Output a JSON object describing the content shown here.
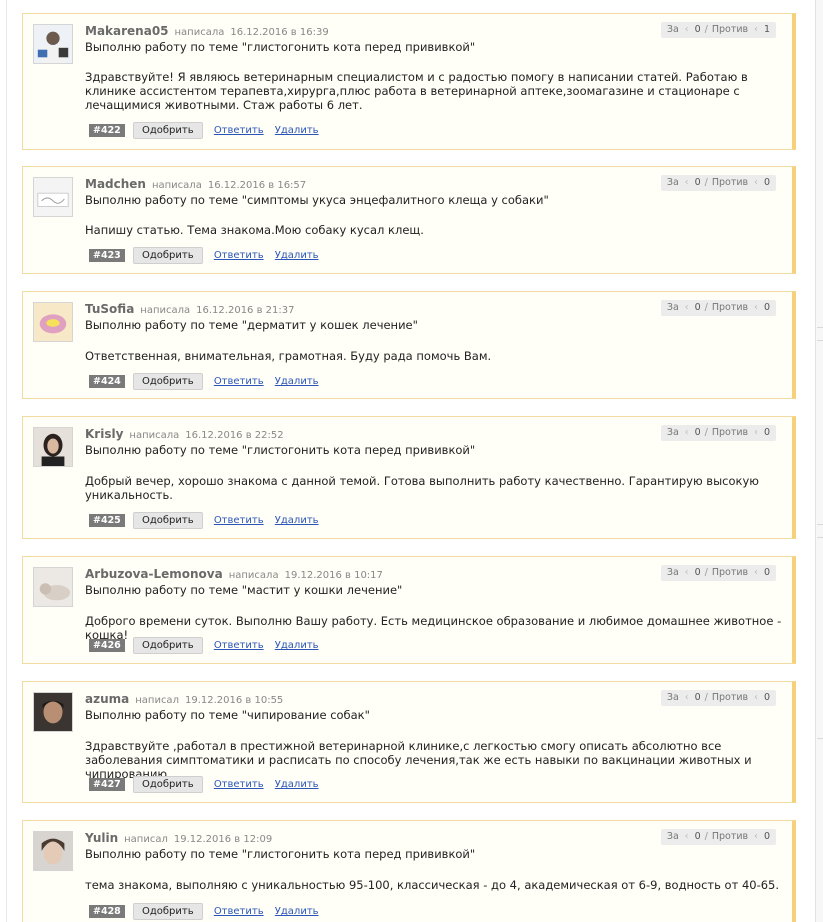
{
  "vote": {
    "for_label": "За",
    "against_label": "Против",
    "sep": "/"
  },
  "labels": {
    "wrote": "написала",
    "wrote_m": "написал",
    "approve": "Одобрить",
    "reply": "Ответить",
    "delete": "Удалить"
  },
  "comments": [
    {
      "author": "Makarena05",
      "verb": "написала",
      "date": "16.12.2016 в 16:39",
      "topic": "Выполню работу по теме \"глистогонить кота перед прививкой\"",
      "text": "Здравствуйте! Я являюсь ветеринарным специалистом и с радостью помогу в написании статей. Работаю в клинике ассистентом терапевта,хирурга,плюс работа в ветеринарной аптеке,зоомагазине и стационаре с лечащимися животными. Стаж работы 6 лет.",
      "number": "#422",
      "votes_for": "0",
      "votes_against": "1"
    },
    {
      "author": "Madchen",
      "verb": "написала",
      "date": "16.12.2016 в 16:57",
      "topic": "Выполню работу по теме \"симптомы укуса энцефалитного клеща у собаки\"",
      "text": "Напишу статью. Тема знакома.Мою собаку кусал клещ.",
      "number": "#423",
      "votes_for": "0",
      "votes_against": "0"
    },
    {
      "author": "TuSofia",
      "verb": "написала",
      "date": "16.12.2016 в 21:37",
      "topic": "Выполню работу по теме \"дерматит у кошек лечение\"",
      "text": "Ответственная, внимательная, грамотная. Буду рада помочь Вам.",
      "number": "#424",
      "votes_for": "0",
      "votes_against": "0"
    },
    {
      "author": "Krisly",
      "verb": "написала",
      "date": "16.12.2016 в 22:52",
      "topic": "Выполню работу по теме \"глистогонить кота перед прививкой\"",
      "text": "Добрый вечер, хорошо знакома с данной темой. Готова выполнить работу качественно. Гарантирую высокую уникальность.",
      "number": "#425",
      "votes_for": "0",
      "votes_against": "0"
    },
    {
      "author": "Arbuzova-Lemonova",
      "verb": "написала",
      "date": "19.12.2016 в 10:17",
      "topic": "Выполню работу по теме \"мастит у кошки лечение\"",
      "text": "Доброго времени суток. Выполню Вашу работу. Есть медицинское образование и любимое домашнее животное - кошка!",
      "number": "#426",
      "votes_for": "0",
      "votes_against": "0"
    },
    {
      "author": "azuma",
      "verb": "написал",
      "date": "19.12.2016 в 10:55",
      "topic": "Выполню работу по теме \"чипирование собак\"",
      "text": "Здравствуйте ,работал в престижной ветеринарной клинике,с легкостью смогу описать абсолютно все заболевания симптоматики и расписать по способу лечения,так же есть навыки по вакцинации животных и чипированию",
      "number": "#427",
      "votes_for": "0",
      "votes_against": "0"
    },
    {
      "author": "Yulin",
      "verb": "написал",
      "date": "19.12.2016 в 12:09",
      "topic": "Выполню работу по теме \"глистогонить кота перед прививкой\"",
      "text": "тема знакома, выполняю с уникальностью 95-100, классическая - до 4, академическая от 6-9, водность от 40-65.",
      "number": "#428",
      "votes_for": "0",
      "votes_against": "0"
    }
  ]
}
